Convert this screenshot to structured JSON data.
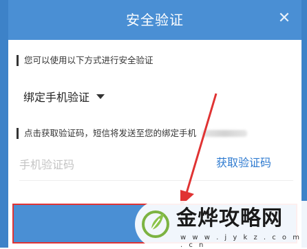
{
  "dialog": {
    "title": "安全验证",
    "close_icon": "close-icon",
    "hint": "您可以使用以下方式进行安全验证",
    "method": {
      "label": "绑定手机验证",
      "icon": "caret-down-icon"
    },
    "sms_hint": "点击获取验证码，短信将发送至您的绑定手机",
    "code_input": {
      "placeholder": "手机验证码",
      "value": ""
    },
    "get_code": "获取验证码",
    "submit_label": ""
  },
  "watermark": {
    "text": "金烨攻略网",
    "url": "w w w . j y k z . c o m . c n",
    "icon": "leaf-logo-icon"
  },
  "colors": {
    "header": "#4a8fd4",
    "link": "#2f7bd0",
    "highlight": "#e03333"
  }
}
